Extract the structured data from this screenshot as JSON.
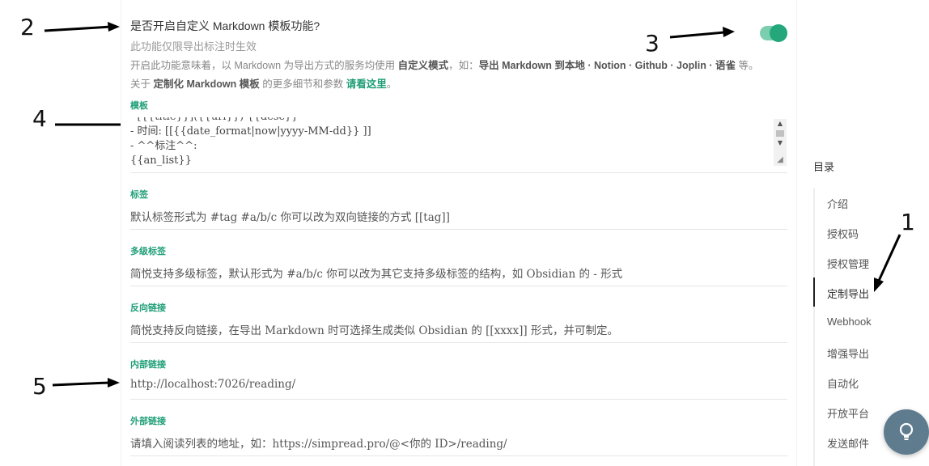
{
  "annotations": {
    "n1": "1",
    "n2": "2",
    "n3": "3",
    "n4": "4",
    "n5": "5"
  },
  "feature": {
    "title": "是否开启自定义 Markdown 模板功能?",
    "note": "此功能仅限导出标注时生效",
    "desc_prefix": "开启此功能意味着，以 Markdown 为导出方式的服务均使用 ",
    "desc_bold1": "自定义模式",
    "desc_mid": "，如：",
    "desc_bold2": "导出 Markdown 到本地 · Notion · Github · Joplin · 语雀",
    "desc_suffix": " 等。",
    "about_prefix": "关于 ",
    "about_bold": "定制化 Markdown 模板",
    "about_mid": " 的更多细节和参数 ",
    "about_link": "请看这里",
    "about_suffix": "。",
    "toggle_on": true
  },
  "template": {
    "label": "模板",
    "lines": [
      "- [{{title}}]({{url}}) {{desc}}",
      "- 时间: [[{{date_format|now|yyyy-MM-dd}} ]]",
      "- ^^标注^^:",
      "{{an_list}}"
    ]
  },
  "fields": [
    {
      "label": "标签",
      "value": "默认标签形式为 #tag #a/b/c 你可以改为双向链接的方式 [[tag]]"
    },
    {
      "label": "多级标签",
      "value": "简悦支持多级标签，默认形式为 #a/b/c 你可以改为其它支持多级标签的结构，如 Obsidian 的 - 形式"
    },
    {
      "label": "反向链接",
      "value": "简悦支持反向链接，在导出 Markdown 时可选择生成类似 Obsidian 的 [[xxxx]] 形式，并可制定。"
    },
    {
      "label": "内部链接",
      "value": "http://localhost:7026/reading/"
    },
    {
      "label": "外部链接",
      "value": "请填入阅读列表的地址，如：https://simpread.pro/@<你的 ID>/reading/"
    }
  ],
  "toc": {
    "title": "目录",
    "items": [
      "介绍",
      "授权码",
      "授权管理",
      "定制导出",
      "Webhook",
      "增强导出",
      "自动化",
      "开放平台",
      "发送邮件"
    ],
    "active_index": 3
  },
  "colors": {
    "accent": "#1e9e77",
    "toggle_track": "#7ccfae",
    "toggle_knob": "#25a77c",
    "fab": "#5f7c8e"
  },
  "icons": {
    "fab": "lightbulb-icon"
  }
}
